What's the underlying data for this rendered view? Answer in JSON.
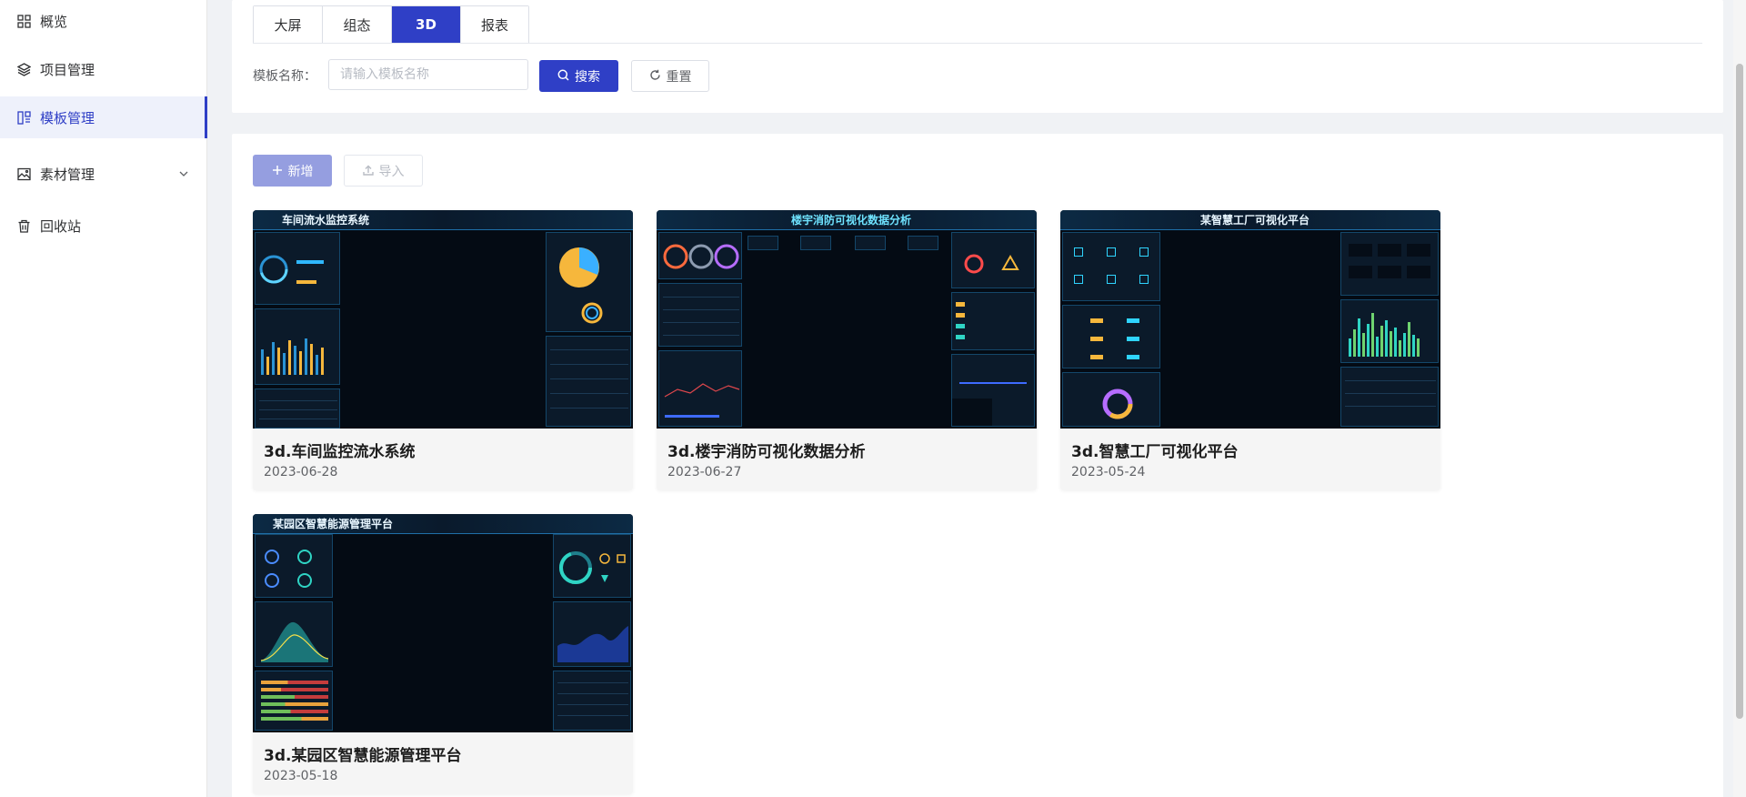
{
  "sidebar": {
    "items": [
      {
        "label": "概览",
        "icon": "grid-icon"
      },
      {
        "label": "项目管理",
        "icon": "layers-icon"
      },
      {
        "label": "模板管理",
        "icon": "template-icon"
      },
      {
        "label": "素材管理",
        "icon": "image-icon"
      },
      {
        "label": "回收站",
        "icon": "trash-icon"
      }
    ],
    "active_index": 2
  },
  "tabs": [
    {
      "label": "大屏"
    },
    {
      "label": "组态"
    },
    {
      "label": "3D"
    },
    {
      "label": "报表"
    }
  ],
  "active_tab": 2,
  "search": {
    "label": "模板名称：",
    "placeholder": "请输入模板名称",
    "value": "",
    "search_button": "搜索",
    "reset_button": "重置"
  },
  "toolbar": {
    "add_button": "新增",
    "import_button": "导入"
  },
  "templates": [
    {
      "title": "3d.车间监控流水系统",
      "date": "2023-06-28",
      "thumb_title": "车间流水监控系统"
    },
    {
      "title": "3d.楼宇消防可视化数据分析",
      "date": "2023-06-27",
      "thumb_title": "楼宇消防可视化数据分析"
    },
    {
      "title": "3d.智慧工厂可视化平台",
      "date": "2023-05-24",
      "thumb_title": "某智慧工厂可视化平台"
    },
    {
      "title": "3d.某园区智慧能源管理平台",
      "date": "2023-05-18",
      "thumb_title": "某园区智慧能源管理平台"
    }
  ],
  "colors": {
    "primary": "#2f3fc6",
    "primary_disabled": "#959ee0",
    "sidebar_active_bg": "#eef1fb",
    "thumb_bg": "#040b14"
  }
}
